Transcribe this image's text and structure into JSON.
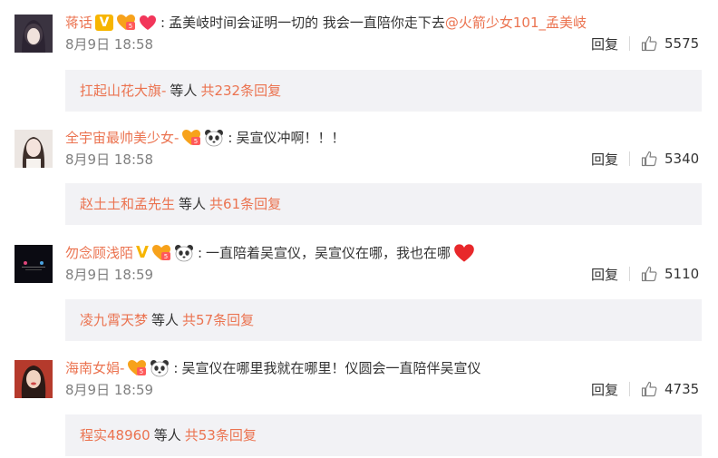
{
  "comments": [
    {
      "username": "蒋话",
      "text": "孟美岐时间会证明一切的 我会一直陪你走下去",
      "mention": "@火箭少女101_孟美岐",
      "date": "8月9日 18:58",
      "reply_label": "回复",
      "likes": "5575",
      "badges": [
        "verified-v-badge",
        "fan-badge",
        "heart-badge"
      ],
      "subreplies": {
        "name": "扛起山花大旗-",
        "middle": "等人",
        "count": "共232条回复"
      }
    },
    {
      "username": "全宇宙最帅美少女-",
      "text": "吴宣仪冲啊！！！",
      "mention": "",
      "date": "8月9日 18:58",
      "reply_label": "回复",
      "likes": "5340",
      "badges": [
        "fan-badge",
        "panda-badge"
      ],
      "subreplies": {
        "name": "赵土土和孟先生",
        "middle": "等人",
        "count": "共61条回复"
      }
    },
    {
      "username": "勿念顾浅陌",
      "text": "一直陪着吴宣仪，吴宣仪在哪，我也在哪",
      "mention": "",
      "date": "8月9日 18:59",
      "reply_label": "回复",
      "likes": "5110",
      "badges": [
        "vip-v-icon",
        "fan-badge",
        "panda-badge"
      ],
      "subreplies": {
        "name": "凌九霄天梦",
        "middle": "等人",
        "count": "共57条回复"
      }
    },
    {
      "username": "海南女娟-",
      "text": "吴宣仪在哪里我就在哪里！仪圆会一直陪伴吴宣仪",
      "mention": "",
      "date": "8月9日 18:59",
      "reply_label": "回复",
      "likes": "4735",
      "badges": [
        "fan-badge",
        "panda-badge"
      ],
      "subreplies": {
        "name": "程实48960",
        "middle": "等人",
        "count": "共53条回复"
      }
    }
  ],
  "colors": {
    "username": "#eb7350",
    "text": "#333333",
    "muted": "#808080",
    "subbox_bg": "#f2f2f5"
  }
}
